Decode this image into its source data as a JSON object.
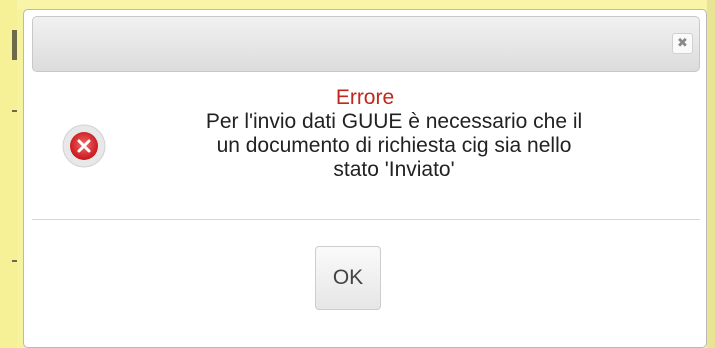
{
  "dialog": {
    "close_icon": "close-icon",
    "error_icon": "error-x-circle-icon",
    "title": "Errore",
    "message_line1": "Per l'invio dati GUUE è necessario che il",
    "message_line2": "un documento di richiesta cig sia nello",
    "message_line3": "stato 'Inviato'",
    "ok_label": "OK"
  },
  "colors": {
    "background": "#f5f2a0",
    "title": "#c0281e",
    "icon": "#d93b3b"
  }
}
